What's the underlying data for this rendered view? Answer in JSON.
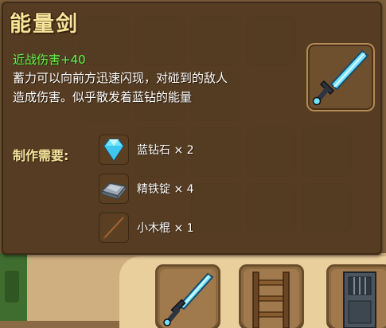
{
  "item": {
    "title": "能量剑",
    "stat": "近战伤害+40",
    "description_line1": "蓄力可以向前方迅速闪现，对碰到的敌人",
    "description_line2": "造成伤害。似乎散发着蓝钻的能量",
    "icon": "energy-sword-icon"
  },
  "crafting": {
    "label": "制作需要:",
    "materials": [
      {
        "name_qty": "蓝钻石 × 2",
        "icon": "blue-diamond-icon"
      },
      {
        "name_qty": "精铁锭 × 4",
        "icon": "refined-iron-ingot-icon"
      },
      {
        "name_qty": "小木棍 × 1",
        "icon": "small-wooden-stick-icon"
      }
    ]
  },
  "hotbar": {
    "slots": [
      {
        "icon": "energy-sword-icon"
      },
      {
        "icon": "wooden-ladder-icon"
      },
      {
        "icon": "iron-door-icon"
      }
    ]
  },
  "colors": {
    "title": "#f6e49a",
    "stat": "#6ef04a",
    "tooltip_bg": "#523a21",
    "diamond": "#6fe3ff"
  }
}
